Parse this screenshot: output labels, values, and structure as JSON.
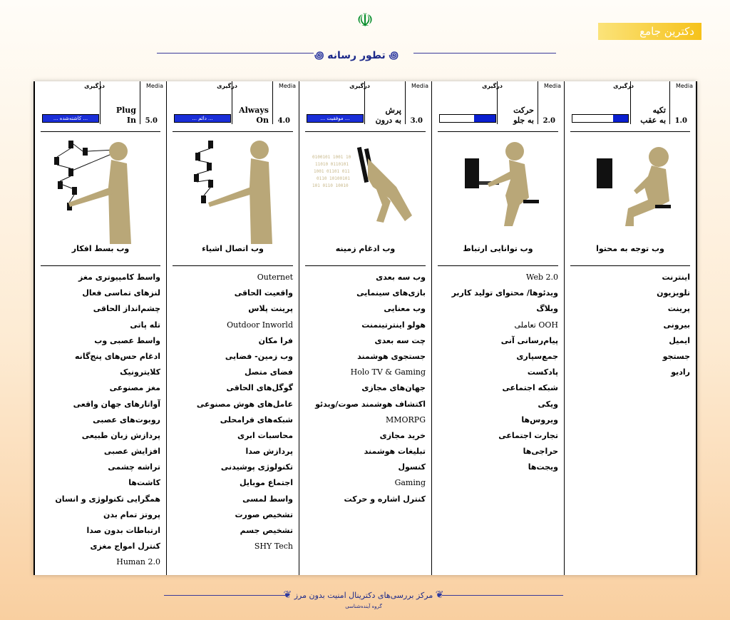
{
  "header": {
    "title": "تطور رسانه",
    "brand": "دکترین جامع",
    "ornament_left": "꩜",
    "ornament_right": "꩜"
  },
  "columns": [
    {
      "version": "1.0",
      "name": "تکیه\nبه عقب",
      "media_label": "Media",
      "engagement_label": "درگیری",
      "engagement_level": 0.27,
      "engagement_text": "",
      "caption": "وب توجه به محتوا",
      "items": [
        "اینترنت",
        "تلویزیون",
        "پرینت",
        "بیرونی",
        "ایمیل",
        "جستجو",
        "رادیو"
      ]
    },
    {
      "version": "2.0",
      "name": "حرکت\nبه جلو",
      "media_label": "Media",
      "engagement_label": "درگیری",
      "engagement_level": 0.38,
      "engagement_text": "",
      "caption": "وب توانایی ارتباط",
      "items": [
        "Web 2.0",
        "ویدئوها/ محتوای تولید کاربر",
        "وبلاگ",
        "OOH تعاملی",
        "پیام‌رسانی آنی",
        "جمع‌سپاری",
        "پادکست",
        "شبکه اجتماعی",
        "ویکی",
        "ویروس‌ها",
        "تجارت اجتماعی",
        "حراجی‌ها",
        "ویجت‌ها"
      ]
    },
    {
      "version": "3.0",
      "name": "پرش\nبه درون",
      "media_label": "Media",
      "engagement_label": "درگیری",
      "engagement_level": 1,
      "engagement_text": "... موفقیت ...",
      "caption": "وب ادغام زمینه",
      "items": [
        "وب سه بعدی",
        "بازی‌های سینمایی",
        "وب معنایی",
        "هولو اینترتینمنت",
        "چت سه بعدی",
        "جستجوی هوشمند",
        "Holo TV & Gaming",
        "جهان‌های مجازی",
        "اکتشاف هوشمند صوت/ویدئو",
        "MMORPG",
        "خرید مجازی",
        "تبلیغات هوشمند",
        "کنسول",
        "Gaming",
        "کنترل اشاره و حرکت"
      ]
    },
    {
      "version": "4.0",
      "name": "Always\nOn",
      "media_label": "Media",
      "engagement_label": "درگیری",
      "engagement_level": 1,
      "engagement_text": "... دائم ...",
      "caption": "وب اتصال اشیاء",
      "items": [
        "Outernet",
        "واقعیت الحاقی",
        "پرینت پلاس",
        "Outdoor Inworld",
        "فرا مکان",
        "وب زمین- فضایی",
        "فضای متصل",
        "گوگل‌های الحاقی",
        "عامل‌های هوش مصنوعی",
        "شبکه‌های فرامحلی",
        "محاسبات ابری",
        "پردازش صدا",
        "تکنولوژی پوشیدنی",
        "اجتماع موبایل",
        "واسط لمسی",
        "تشخیص صورت",
        "تشخیص جسم",
        "SHY Tech"
      ]
    },
    {
      "version": "5.0",
      "name": "Plug\nIn",
      "media_label": "Media",
      "engagement_label": "درگیری",
      "engagement_level": 1,
      "engagement_text": "... کاشته‌شده ...",
      "caption": "وب بسط افکار",
      "items": [
        "واسط کامپیوتری مغز",
        "لنزهای تماسی فعال",
        "چشم‌انداز الحاقی",
        "تله پاتی",
        "واسط عصبی وب",
        "ادغام حس‌های پنج‌گانه",
        "کلایترونیک",
        "مغز مصنوعی",
        "آواتارهای جهان واقعی",
        "روبوت‌های عصبی",
        "پردازش زبان طبیعی",
        "افزایش عصبی",
        "تراشه چشمی",
        "کاشت‌ها",
        "همگرایی تکنولوژی و انسان",
        "پروتز تمام بدن",
        "ارتباطات بدون صدا",
        "کنترل امواج مغزی",
        "Human 2.0"
      ]
    }
  ],
  "footer": {
    "text": "مرکز بررسی‌های دکترینال امنیت بدون مرز",
    "subtext": "گروه آینده‌شناسی"
  }
}
